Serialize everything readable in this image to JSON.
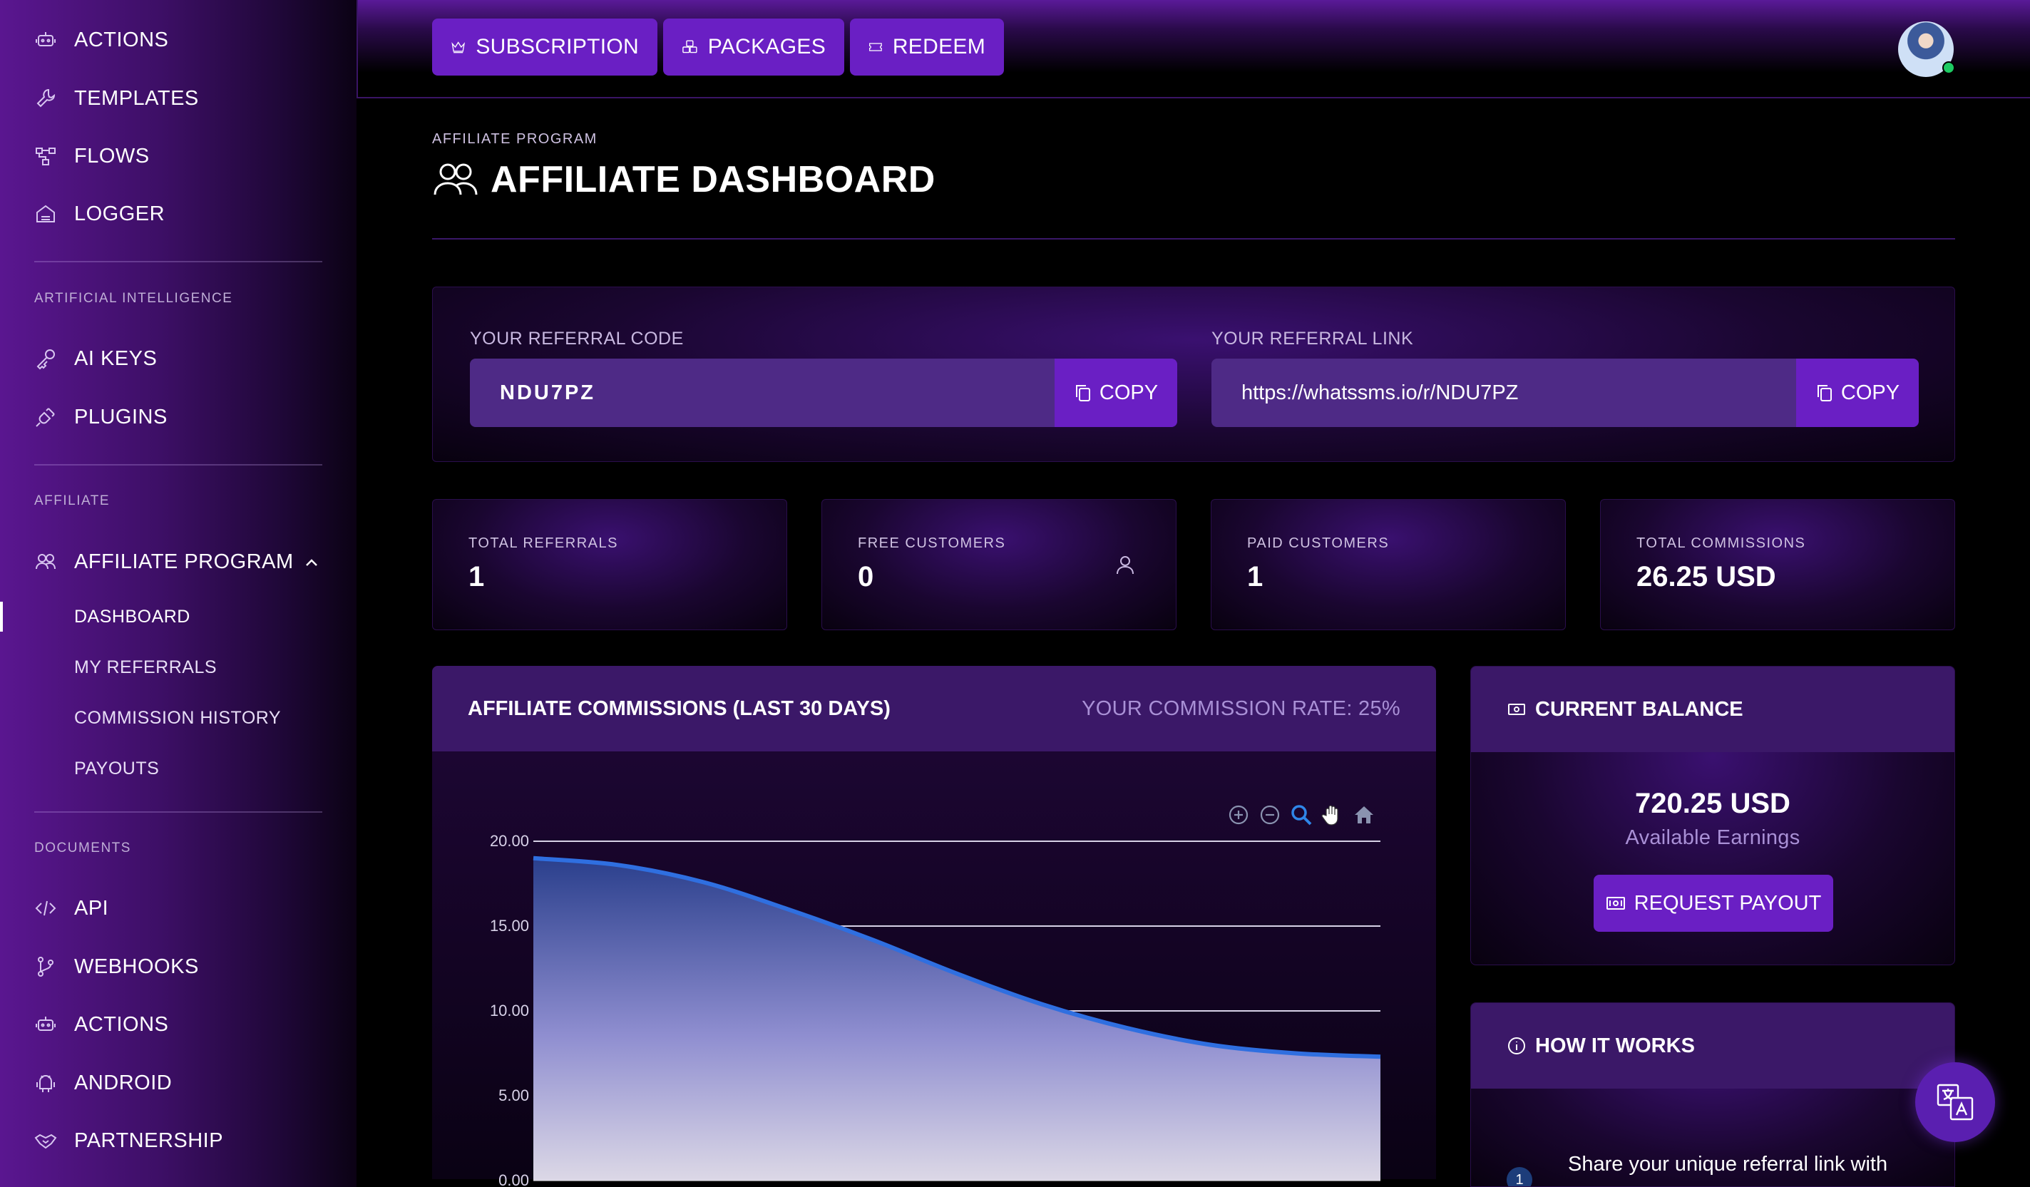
{
  "sidebar": {
    "top_items": [
      "ACTIONS",
      "TEMPLATES",
      "FLOWS",
      "LOGGER"
    ],
    "ai_section": "ARTIFICIAL INTELLIGENCE",
    "ai_items": [
      "AI KEYS",
      "PLUGINS"
    ],
    "affiliate_section": "AFFILIATE",
    "affiliate_program": "AFFILIATE PROGRAM",
    "affiliate_sub": [
      "DASHBOARD",
      "MY REFERRALS",
      "COMMISSION HISTORY",
      "PAYOUTS"
    ],
    "documents_section": "DOCUMENTS",
    "doc_items": [
      "API",
      "WEBHOOKS",
      "ACTIONS",
      "ANDROID",
      "PARTNERSHIP"
    ]
  },
  "topbar": {
    "subscription": "SUBSCRIPTION",
    "packages": "PACKAGES",
    "redeem": "REDEEM"
  },
  "header": {
    "breadcrumb": "AFFILIATE PROGRAM",
    "title": "AFFILIATE DASHBOARD"
  },
  "referral": {
    "code_label": "YOUR REFERRAL CODE",
    "code": "NDU7PZ",
    "link_label": "YOUR REFERRAL LINK",
    "link": "https://whatssms.io/r/NDU7PZ",
    "copy": "COPY"
  },
  "stats": [
    {
      "label": "TOTAL REFERRALS",
      "value": "1"
    },
    {
      "label": "FREE CUSTOMERS",
      "value": "0"
    },
    {
      "label": "PAID CUSTOMERS",
      "value": "1"
    },
    {
      "label": "TOTAL COMMISSIONS",
      "value": "26.25 USD"
    }
  ],
  "chart_card": {
    "title": "AFFILIATE COMMISSIONS (LAST 30 DAYS)",
    "rate": "YOUR COMMISSION RATE: 25%"
  },
  "chart_data": {
    "type": "area",
    "title": "AFFILIATE COMMISSIONS (LAST 30 DAYS)",
    "y_ticks": [
      "20.00",
      "15.00",
      "10.00",
      "5.00",
      "0.00"
    ],
    "ylim": [
      0,
      20
    ],
    "x": [
      0,
      1,
      2,
      3,
      4,
      5,
      6,
      7,
      8,
      9,
      10
    ],
    "values": [
      19,
      18.6,
      17.6,
      16.0,
      14.2,
      12.2,
      10.4,
      9.0,
      8.0,
      7.5,
      7.3
    ],
    "grid": true,
    "line_color": "#2f6fe0"
  },
  "balance": {
    "title": "CURRENT BALANCE",
    "amount": "720.25 USD",
    "sub": "Available Earnings",
    "payout": "REQUEST PAYOUT"
  },
  "how": {
    "title": "HOW IT WORKS",
    "step_num": "1",
    "step_text": "Share your unique referral link with"
  }
}
